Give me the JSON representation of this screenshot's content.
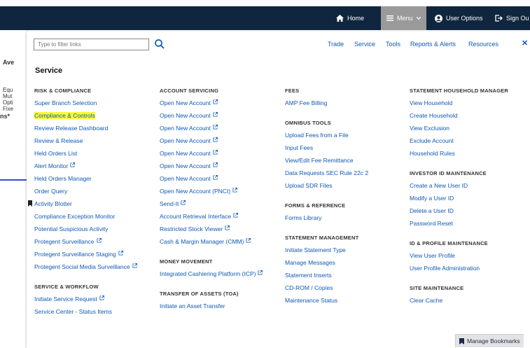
{
  "nav": {
    "home": "Home",
    "menu": "Menu",
    "user_options": "User Options",
    "sign_out": "Sign Ou"
  },
  "page_left": {
    "heading": "Ave",
    "lines": [
      "Equ",
      "Mut",
      "Opti",
      "Fixe"
    ],
    "suffix": "ns*"
  },
  "panel": {
    "filter_placeholder": "Type to filter links",
    "top_links": [
      "Trade",
      "Service",
      "Tools",
      "Reports & Alerts",
      "Resources"
    ],
    "close": "✕",
    "title": "Service",
    "manage_bookmarks": "Manage Bookmarks",
    "columns": [
      [
        {
          "type": "header",
          "text": "RISK & COMPLIANCE"
        },
        {
          "type": "link",
          "text": "Super Branch Selection"
        },
        {
          "type": "link",
          "text": "Compliance & Controls",
          "highlight": true
        },
        {
          "type": "link",
          "text": "Review Release Dashboard"
        },
        {
          "type": "link",
          "text": "Review & Release"
        },
        {
          "type": "link",
          "text": "Held Orders List"
        },
        {
          "type": "link",
          "text": "Alert Monitor",
          "ext": true
        },
        {
          "type": "link",
          "text": "Held Orders Manager"
        },
        {
          "type": "link",
          "text": "Order Query"
        },
        {
          "type": "link",
          "text": "Activity Blotter",
          "bookmark": true
        },
        {
          "type": "link",
          "text": "Compliance Exception Monitor"
        },
        {
          "type": "link",
          "text": "Potential Suspicious Activity"
        },
        {
          "type": "link",
          "text": "Protegent Surveillance",
          "ext": true
        },
        {
          "type": "link",
          "text": "Protegent Surveillance Staging",
          "ext": true
        },
        {
          "type": "link",
          "text": "Protegent Social Media Surveillance",
          "ext": true
        },
        {
          "type": "gap"
        },
        {
          "type": "header",
          "text": "SERVICE & WORKFLOW"
        },
        {
          "type": "link",
          "text": "Initiate Service Request",
          "ext": true
        },
        {
          "type": "link",
          "text": "Service Center - Status Items"
        }
      ],
      [
        {
          "type": "header",
          "text": "ACCOUNT SERVICING"
        },
        {
          "type": "link",
          "text": "Open New Account",
          "ext": true
        },
        {
          "type": "link",
          "text": "Open New Account",
          "ext": true
        },
        {
          "type": "link",
          "text": "Open New Account",
          "ext": true
        },
        {
          "type": "link",
          "text": "Open New Account",
          "ext": true
        },
        {
          "type": "link",
          "text": "Open New Account",
          "ext": true
        },
        {
          "type": "link",
          "text": "Open New Account",
          "ext": true
        },
        {
          "type": "link",
          "text": "Open New Account",
          "ext": true
        },
        {
          "type": "link",
          "text": "Open New Account (PNCI)",
          "ext": true
        },
        {
          "type": "link",
          "text": "Send-It",
          "ext": true
        },
        {
          "type": "link",
          "text": "Account Retrieval Interface",
          "ext": true
        },
        {
          "type": "link",
          "text": "Restricted Stock Viewer",
          "ext": true
        },
        {
          "type": "link",
          "text": "Cash & Margin Manager (CMM)",
          "ext": true
        },
        {
          "type": "gap"
        },
        {
          "type": "header",
          "text": "MONEY MOVEMENT"
        },
        {
          "type": "link",
          "text": "Integrated Cashiering Platform (ICP)",
          "ext": true
        },
        {
          "type": "gap"
        },
        {
          "type": "header",
          "text": "TRANSFER OF ASSETS (TOA)"
        },
        {
          "type": "link",
          "text": "Initiate an Asset Transfer"
        }
      ],
      [
        {
          "type": "header",
          "text": "FEES"
        },
        {
          "type": "link",
          "text": "AMP Fee Billing"
        },
        {
          "type": "gap"
        },
        {
          "type": "header",
          "text": "OMNIBUS TOOLS"
        },
        {
          "type": "link",
          "text": "Upload Fees from a File"
        },
        {
          "type": "link",
          "text": "Input Fees"
        },
        {
          "type": "link",
          "text": "View/Edit Fee Remittance"
        },
        {
          "type": "link",
          "text": "Data Requests SEC Rule 22c 2"
        },
        {
          "type": "link",
          "text": "Upload SDR Files"
        },
        {
          "type": "gap"
        },
        {
          "type": "header",
          "text": "FORMS & REFERENCE"
        },
        {
          "type": "link",
          "text": "Forms Library"
        },
        {
          "type": "gap"
        },
        {
          "type": "header",
          "text": "STATEMENT MANAGEMENT"
        },
        {
          "type": "link",
          "text": "Initiate Statement Type"
        },
        {
          "type": "link",
          "text": "Manage Messages"
        },
        {
          "type": "link",
          "text": "Statement Inserts"
        },
        {
          "type": "link",
          "text": "CD-ROM / Copies"
        },
        {
          "type": "link",
          "text": "Maintenance Status"
        }
      ],
      [
        {
          "type": "header",
          "text": "STATEMENT HOUSEHOLD MANAGER"
        },
        {
          "type": "link",
          "text": "View Household"
        },
        {
          "type": "link",
          "text": "Create Household"
        },
        {
          "type": "link",
          "text": "View Exclusion"
        },
        {
          "type": "link",
          "text": "Exclude Account"
        },
        {
          "type": "link",
          "text": "Household Rules"
        },
        {
          "type": "gap"
        },
        {
          "type": "header",
          "text": "INVESTOR ID MAINTENANCE"
        },
        {
          "type": "link",
          "text": "Create a New User ID"
        },
        {
          "type": "link",
          "text": "Modify a User ID"
        },
        {
          "type": "link",
          "text": "Delete a User ID"
        },
        {
          "type": "link",
          "text": "Password Reset"
        },
        {
          "type": "gap"
        },
        {
          "type": "header",
          "text": "ID & PROFILE MAINTENANCE"
        },
        {
          "type": "link",
          "text": "View User Profile"
        },
        {
          "type": "link",
          "text": "User Profile Administration"
        },
        {
          "type": "gap"
        },
        {
          "type": "header",
          "text": "SITE MAINTENANCE"
        },
        {
          "type": "link",
          "text": "Clear Cache"
        }
      ]
    ]
  }
}
